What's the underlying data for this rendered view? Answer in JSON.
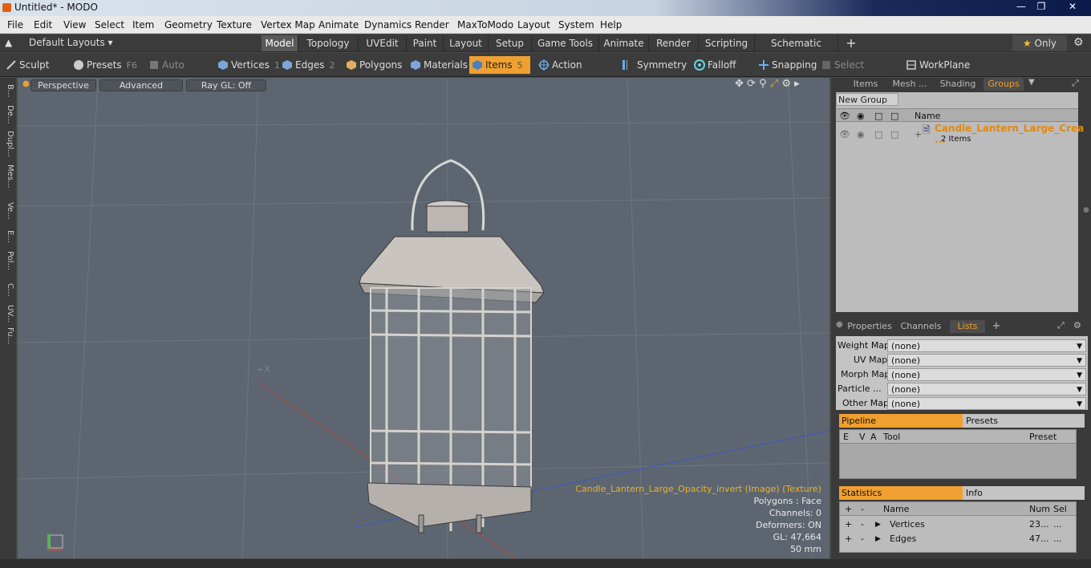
{
  "window": {
    "title": "Untitled* - MODO"
  },
  "menu": [
    "File",
    "Edit",
    "View",
    "Select",
    "Item",
    "Geometry",
    "Texture",
    "Vertex Map",
    "Animate",
    "Dynamics",
    "Render",
    "MaxToModo",
    "Layout",
    "System",
    "Help"
  ],
  "layouts": {
    "default_label": "Default Layouts",
    "tabs": [
      "Model",
      "Topology",
      "UVEdit",
      "Paint",
      "Layout",
      "Setup",
      "Game Tools",
      "Animate",
      "Render",
      "Scripting",
      "Schematic Fusion"
    ],
    "add": "+",
    "only_label": "Only"
  },
  "toolbar": {
    "sculpt": "Sculpt",
    "presets": "Presets",
    "presets_key": "F6",
    "auto_select": "Auto Select",
    "vertices": "Vertices",
    "vertices_key": "1",
    "edges": "Edges",
    "edges_key": "2",
    "polygons": "Polygons",
    "materials": "Materials",
    "items": "Items",
    "items_key": "5",
    "action_center": "Action Center",
    "symmetry": "Symmetry",
    "falloff": "Falloff",
    "snapping": "Snapping",
    "select_through": "Select Through",
    "workplane": "WorkPlane"
  },
  "left_strip": [
    "B...",
    "De...",
    "Dupl...",
    "Mes...",
    "Ve...",
    "E...",
    "Pol...",
    "C...",
    "UV...",
    "Fu..."
  ],
  "viewport": {
    "perspective": "Perspective",
    "advanced": "Advanced",
    "raygl": "Ray GL: Off",
    "info": [
      "Candle_Lantern_Large_Opacity_invert (Image) (Texture)",
      "Polygons : Face",
      "Channels: 0",
      "Deformers: ON",
      "GL: 47,664",
      "50 mm"
    ],
    "center_label": "+X"
  },
  "items_panel": {
    "tabs": [
      "Items",
      "Mesh ...",
      "Shading",
      "Groups"
    ],
    "active_tab": "Groups",
    "new_group": "New Group",
    "col_name": "Name",
    "group_name": "Candle_Lantern_Large_Crea ...",
    "group_count": "2 Items"
  },
  "props_panel": {
    "tabs": [
      "Properties",
      "Channels",
      "Lists"
    ],
    "active_tab": "Lists",
    "add": "+",
    "maps": [
      {
        "label": "Weight Map",
        "value": "(none)"
      },
      {
        "label": "UV Map",
        "value": "(none)"
      },
      {
        "label": "Morph Map",
        "value": "(none)"
      },
      {
        "label": "Particle  ...",
        "value": "(none)"
      },
      {
        "label": "Other Map",
        "value": "(none)"
      }
    ],
    "pipeline": "Pipeline",
    "presets": "Presets",
    "pipeline_cols": [
      "E",
      "V",
      "A",
      "Tool",
      "Preset"
    ],
    "statistics": "Statistics",
    "info": "Info",
    "stats_cols": [
      "+",
      "-",
      "Name",
      "Num",
      "Sel"
    ],
    "stats_rows": [
      {
        "plus": "+",
        "minus": "-",
        "name": "Vertices",
        "num": "23...",
        "sel": "..."
      },
      {
        "plus": "+",
        "minus": "-",
        "name": "Edges",
        "num": "47...",
        "sel": "..."
      }
    ]
  },
  "colors": {
    "accent": "#f0a030",
    "viewport_bg": "#5d6670"
  }
}
